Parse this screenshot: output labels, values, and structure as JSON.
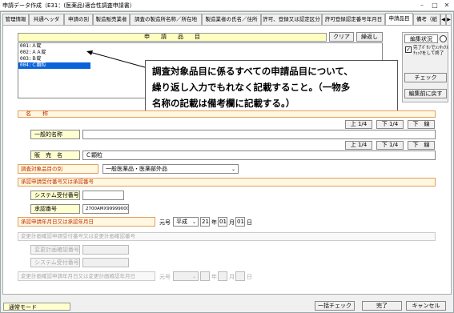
{
  "window": {
    "title": "申請データ作成（E31：(医薬品)適合性調査申請書）"
  },
  "tabs": [
    "管理情報",
    "共通ヘッダ",
    "申請の別",
    "製造販売業者",
    "調査の製造所名称／所在地",
    "製造業者の氏名／住所",
    "許可、登録又は認定区分",
    "許可登録認定番号年月日",
    "申請品目",
    "備考（紙"
  ],
  "product": {
    "header": "申　　請　　品　　目",
    "clear_label": "クリア",
    "repeat_label": "繰返し",
    "items": [
      "001:Ａ錠",
      "002:ＡＡ錠",
      "003:Ｂ錠",
      "004:Ｃ顆粒"
    ],
    "selected_index": 3
  },
  "side": {
    "edit_status_label": "編集状況",
    "checkbox_label": "完了ﾎﾞﾀﾝでｼﾝﾀｯｸｽﾁｪｯｸをして終了",
    "check_label": "チェック",
    "restore_label": "編集前に戻す"
  },
  "callout": {
    "line1": "調査対象品目に係るすべての申請品目について、",
    "line2": "繰り返し入力でもれなく記載すること。（一物多",
    "line3": "名称の記載は備考欄に記載する。）"
  },
  "name_section": {
    "label": "名　　称",
    "up_label": "上 1/4",
    "down_label": "下 1/4",
    "underline_label": "下　線",
    "generic_label": "一般的名称",
    "generic_value": "",
    "brand_label": "販　売　名",
    "brand_value": "Ｃ顆粒"
  },
  "category": {
    "label": "調査対象品目の別",
    "value": "一般医薬品・医薬部外品"
  },
  "approval": {
    "section_label": "承認申請受付番号又は承認番号",
    "system_label": "システム受付番号",
    "system_value": "",
    "approval_label": "承認番号",
    "approval_value": "2700AMX999990000"
  },
  "approval_date": {
    "section_label": "承認申請年月日又は承認年月日",
    "era_prefix": "元号",
    "era_value": "平成",
    "year": "21",
    "year_unit": "年",
    "month": "01",
    "month_unit": "月",
    "day": "01",
    "day_unit": "日"
  },
  "change_plan": {
    "section_label": "変更計画確認申請受付番号又は変更計画確認番号",
    "confirm_label": "変更計画確認番号",
    "system_label": "システム受付番号",
    "date_section_label": "変更計画確認申請年月日又は変更計画確認年月日",
    "era_prefix": "元号",
    "year_unit": "年",
    "month_unit": "月",
    "day_unit": "日"
  },
  "footer": {
    "mode": "通常モード",
    "batch_check": "一括チェック",
    "complete": "完了",
    "cancel": "キャンセル"
  }
}
